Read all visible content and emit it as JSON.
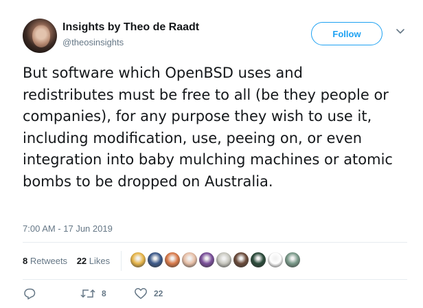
{
  "author": {
    "name": "Insights by Theo de Raadt",
    "handle": "@theosinsights"
  },
  "follow_label": "Follow",
  "tweet_text": "But software which OpenBSD uses and redistributes must be free to all (be they people or companies), for any purpose they wish to use it, including modification, use, peeing on, or even integration into baby mulching machines or atomic bombs to be dropped on Australia.",
  "timestamp": "7:00 AM - 17 Jun 2019",
  "stats": {
    "retweets_count": "8",
    "retweets_label": "Retweets",
    "likes_count": "22",
    "likes_label": "Likes"
  },
  "actions": {
    "retweet_count": "8",
    "like_count": "22"
  },
  "icons": {
    "more": "chevron-down-icon",
    "reply": "reply-icon",
    "retweet": "retweet-icon",
    "like": "heart-icon"
  },
  "colors": {
    "accent": "#1da1f2",
    "secondary_text": "#657786",
    "primary_text": "#14171a",
    "divider": "#e6ecf0"
  },
  "liker_avatars": [
    {
      "name": "liker-avatar-1",
      "color": "#e8b64a"
    },
    {
      "name": "liker-avatar-2",
      "color": "#3d5a8a"
    },
    {
      "name": "liker-avatar-3",
      "color": "#d97a4a"
    },
    {
      "name": "liker-avatar-4",
      "color": "#e8c0a8"
    },
    {
      "name": "liker-avatar-5",
      "color": "#7a4f9a"
    },
    {
      "name": "liker-avatar-6",
      "color": "#c8c8c0"
    },
    {
      "name": "liker-avatar-7",
      "color": "#6a4a3a"
    },
    {
      "name": "liker-avatar-8",
      "color": "#2a4a3a"
    },
    {
      "name": "liker-avatar-9",
      "color": "#ffffff"
    },
    {
      "name": "liker-avatar-10",
      "color": "#7a9a8a"
    }
  ]
}
